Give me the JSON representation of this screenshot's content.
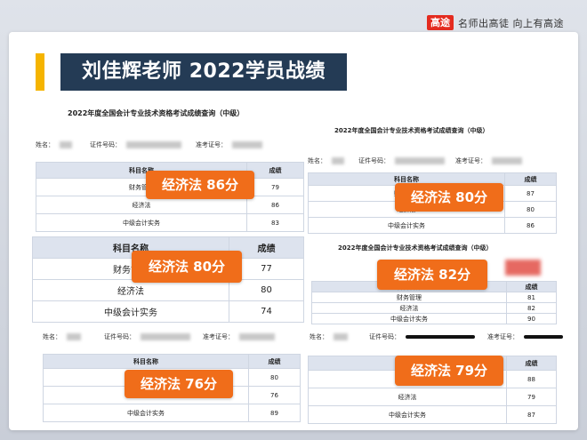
{
  "brand": {
    "logo": "高途",
    "slogan": "名师出高徒 向上有高途"
  },
  "title": "刘佳辉老师 2022学员战绩",
  "labels": {
    "name": "姓名：",
    "cert": "证件号码：",
    "ticket": "准考证号：",
    "subject_header": "科目名称",
    "score_header": "成绩"
  },
  "doc_title": "2022年度全国会计专业技术资格考试成绩查询（中级）",
  "subjects": {
    "finance": "财务管理",
    "economics": "经济法",
    "practice": "中级会计实务"
  },
  "records": [
    {
      "scores": [
        "79",
        "86",
        "83"
      ],
      "badge": "经济法 86分"
    },
    {
      "scores": [
        "87",
        "80",
        "86"
      ],
      "badge": "经济法 80分"
    },
    {
      "scores": [
        "77",
        "80",
        "74"
      ],
      "badge": "经济法 80分"
    },
    {
      "scores": [
        "81",
        "82",
        "90"
      ],
      "badge": "经济法 82分"
    },
    {
      "scores": [
        "80",
        "76",
        "89"
      ],
      "badge": "经济法 76分"
    },
    {
      "scores": [
        "88",
        "79",
        "87"
      ],
      "badge": "经济法 79分"
    }
  ],
  "colors": {
    "banner": "#243b55",
    "accent": "#f5b400",
    "badge": "#f06d1a",
    "brand": "#e42b1f"
  }
}
